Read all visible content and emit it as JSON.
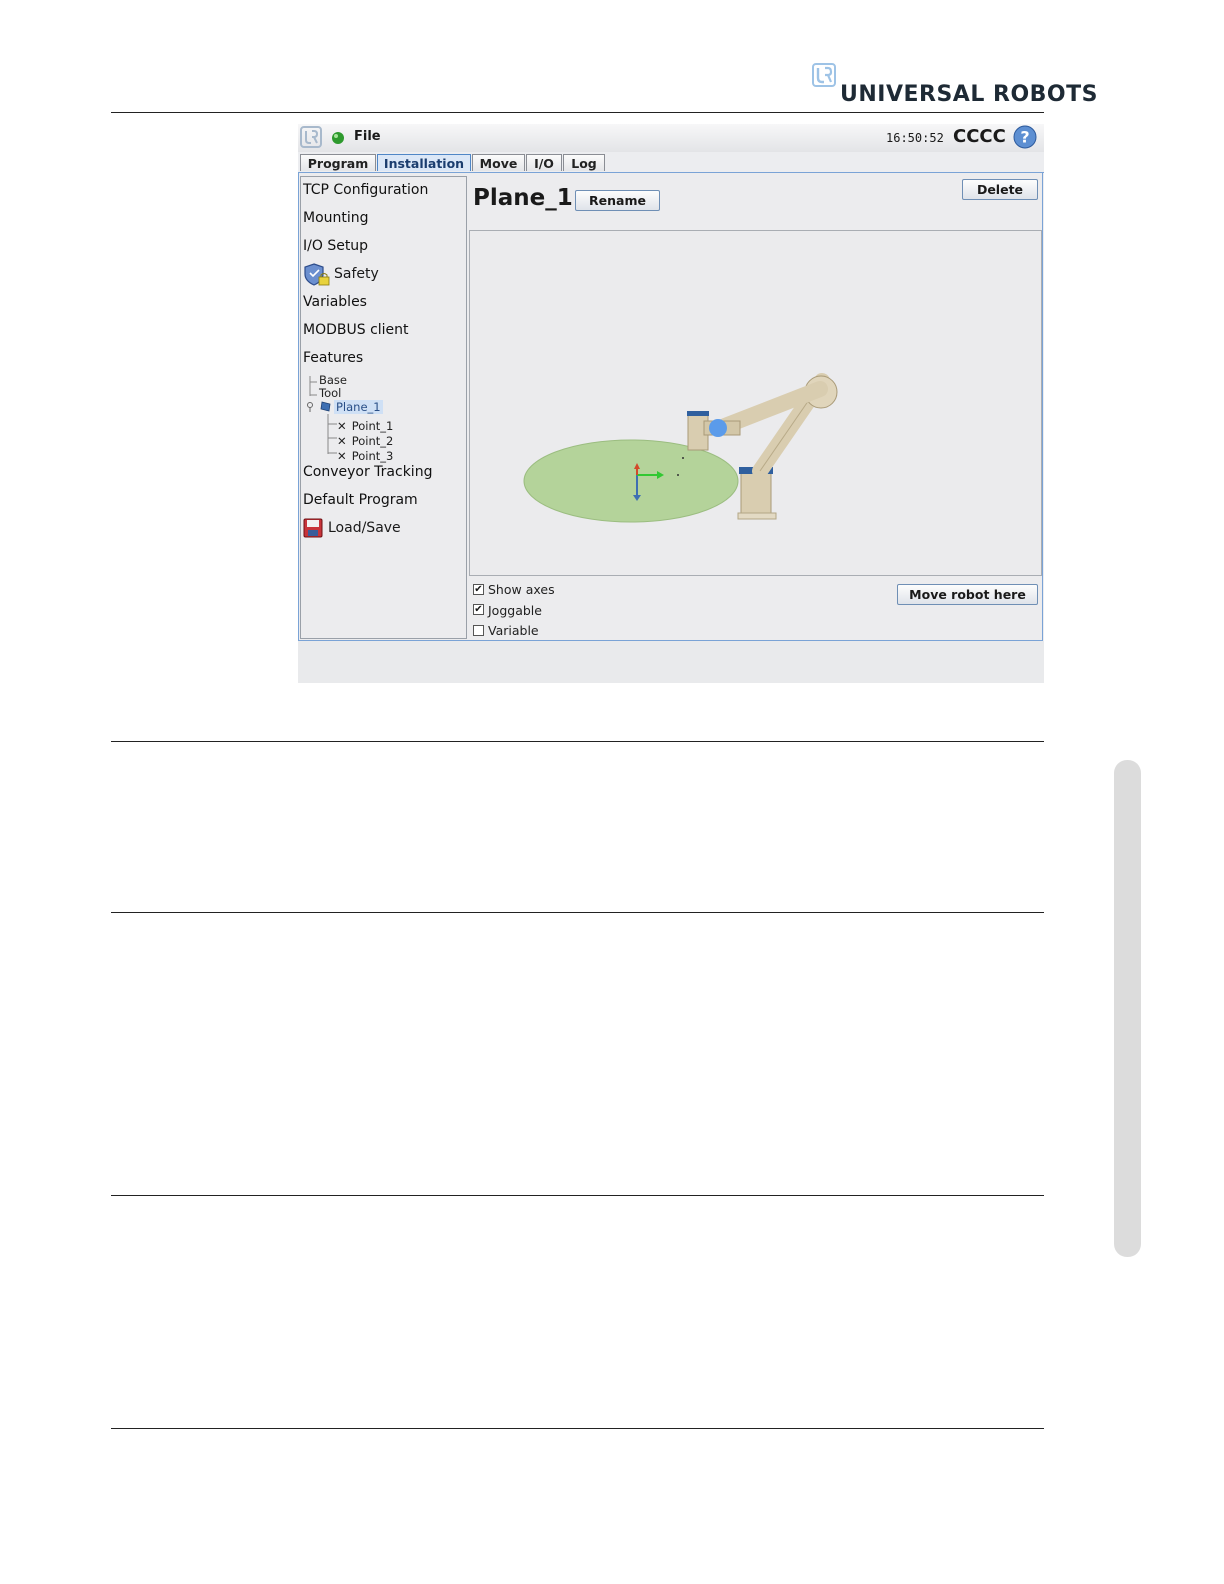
{
  "brand": {
    "name": "UNIVERSAL ROBOTS"
  },
  "topbar": {
    "menu": "File",
    "time": "16:50:52",
    "robot_name": "CCCC"
  },
  "tabs": [
    {
      "label": "Program"
    },
    {
      "label": "Installation"
    },
    {
      "label": "Move"
    },
    {
      "label": "I/O"
    },
    {
      "label": "Log"
    }
  ],
  "sidebar": {
    "items": [
      {
        "label": "TCP Configuration"
      },
      {
        "label": "Mounting"
      },
      {
        "label": "I/O Setup"
      },
      {
        "label": "Safety"
      },
      {
        "label": "Variables"
      },
      {
        "label": "MODBUS client"
      },
      {
        "label": "Features"
      },
      {
        "label": "Conveyor Tracking"
      },
      {
        "label": "Default Program"
      },
      {
        "label": "Load/Save"
      }
    ],
    "features_tree": {
      "base": "Base",
      "tool": "Tool",
      "plane": "Plane_1",
      "points": [
        "Point_1",
        "Point_2",
        "Point_3"
      ]
    }
  },
  "main": {
    "title": "Plane_1",
    "rename_label": "Rename",
    "delete_label": "Delete",
    "move_label": "Move robot here",
    "options": [
      {
        "label": "Show axes",
        "checked": true
      },
      {
        "label": "Joggable",
        "checked": true
      },
      {
        "label": "Variable",
        "checked": false
      }
    ]
  },
  "colors": {
    "accent": "#4f86c6",
    "plane": "#b4d39a",
    "robot": "#d9cdb0",
    "joint_cap": "#2f5f9e"
  }
}
